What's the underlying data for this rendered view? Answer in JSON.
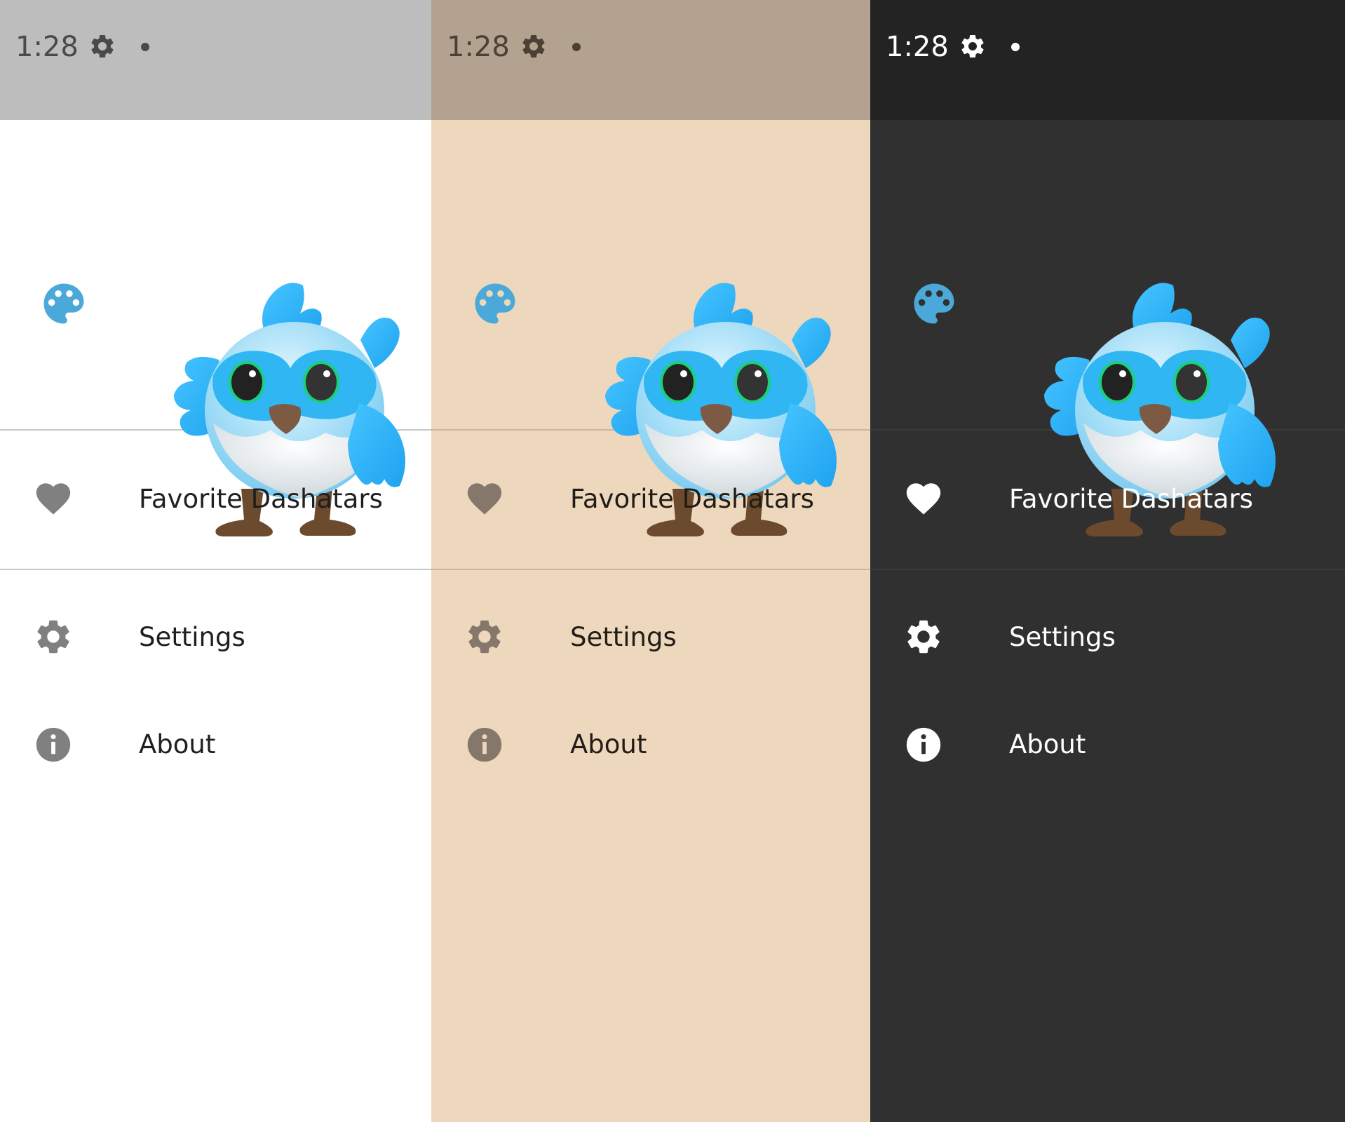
{
  "screens": [
    {
      "theme_name": "light",
      "colors": {
        "status_bg": "#bdbdbd",
        "status_fg": "#4a4a4a",
        "body_bg": "#ffffff",
        "text": "#1f1f1f",
        "icon": "#808080",
        "divider": "#c8c8c8",
        "accent": "#4aa9d8"
      },
      "status": {
        "time": "1:28",
        "gear_icon": "gear-icon",
        "dot_icon": "notification-dot"
      },
      "header": {
        "icon": "palette-icon",
        "mascot": "dashatar-mascot"
      },
      "menu": [
        {
          "icon": "heart-icon",
          "label": "Favorite Dashatars"
        },
        {
          "icon": "settings-icon",
          "label": "Settings"
        },
        {
          "icon": "info-icon",
          "label": "About"
        }
      ]
    },
    {
      "theme_name": "sepia",
      "colors": {
        "status_bg": "#b3a28f",
        "status_fg": "#4a4036",
        "body_bg": "#eed8bd",
        "text": "#221c16",
        "icon": "#85786b",
        "divider": "#c9b6a0",
        "accent": "#4aa9d8"
      },
      "status": {
        "time": "1:28",
        "gear_icon": "gear-icon",
        "dot_icon": "notification-dot"
      },
      "header": {
        "icon": "palette-icon",
        "mascot": "dashatar-mascot"
      },
      "menu": [
        {
          "icon": "heart-icon",
          "label": "Favorite Dashatars"
        },
        {
          "icon": "settings-icon",
          "label": "Settings"
        },
        {
          "icon": "info-icon",
          "label": "About"
        }
      ]
    },
    {
      "theme_name": "dark",
      "colors": {
        "status_bg": "#232323",
        "status_fg": "#ffffff",
        "body_bg": "#303030",
        "text": "#ffffff",
        "icon": "#ffffff",
        "divider": "#3a3a3a",
        "accent": "#4aa9d8"
      },
      "status": {
        "time": "1:28",
        "gear_icon": "gear-icon",
        "dot_icon": "notification-dot"
      },
      "header": {
        "icon": "palette-icon",
        "mascot": "dashatar-mascot"
      },
      "menu": [
        {
          "icon": "heart-icon",
          "label": "Favorite Dashatars"
        },
        {
          "icon": "settings-icon",
          "label": "Settings"
        },
        {
          "icon": "info-icon",
          "label": "About"
        }
      ]
    }
  ]
}
